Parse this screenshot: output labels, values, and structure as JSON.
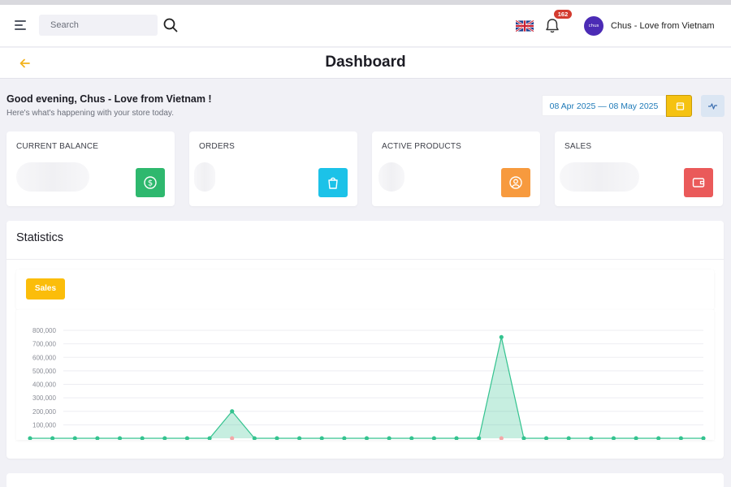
{
  "header": {
    "search_placeholder": "Search",
    "notification_count": "162",
    "user_name": "Chus - Love from Vietnam",
    "avatar_text": "chus"
  },
  "page": {
    "title": "Dashboard",
    "greeting": "Good evening, Chus - Love from Vietnam !",
    "subtitle": "Here's what's happening with your store today.",
    "date_range": "08 Apr 2025 — 08 May 2025"
  },
  "cards": [
    {
      "label": "CURRENT BALANCE",
      "icon": "dollar-icon",
      "color": "#2eb86e"
    },
    {
      "label": "ORDERS",
      "icon": "shopping-bag-icon",
      "color": "#1cc2e8"
    },
    {
      "label": "ACTIVE PRODUCTS",
      "icon": "user-circle-icon",
      "color": "#f79a3e"
    },
    {
      "label": "SALES",
      "icon": "wallet-icon",
      "color": "#ea5a5a"
    }
  ],
  "statistics": {
    "title": "Statistics",
    "active_tab": "Sales"
  },
  "colors": {
    "accent": "#f5c211",
    "series": "#34c38f",
    "series2": "#f4a7a7"
  },
  "chart_data": {
    "type": "area",
    "y_ticks": [
      "100,000",
      "200,000",
      "300,000",
      "400,000",
      "500,000",
      "600,000",
      "700,000",
      "800,000"
    ],
    "ylim": [
      0,
      800000
    ],
    "grid": true,
    "series": [
      {
        "values": [
          0,
          0,
          0,
          0,
          0,
          0,
          0,
          0,
          0,
          200000,
          0,
          0,
          0,
          0,
          0,
          0,
          0,
          0,
          0,
          0,
          0,
          750000,
          0,
          0,
          0,
          0,
          0,
          0,
          0,
          0,
          0
        ]
      },
      {
        "values": [
          0,
          0,
          0,
          0,
          0,
          0,
          0,
          0,
          0,
          0,
          0,
          0,
          0,
          0,
          0,
          0,
          0,
          0,
          0,
          0,
          0,
          0,
          0,
          0,
          0,
          0,
          0,
          0,
          0,
          0,
          0
        ]
      }
    ]
  }
}
